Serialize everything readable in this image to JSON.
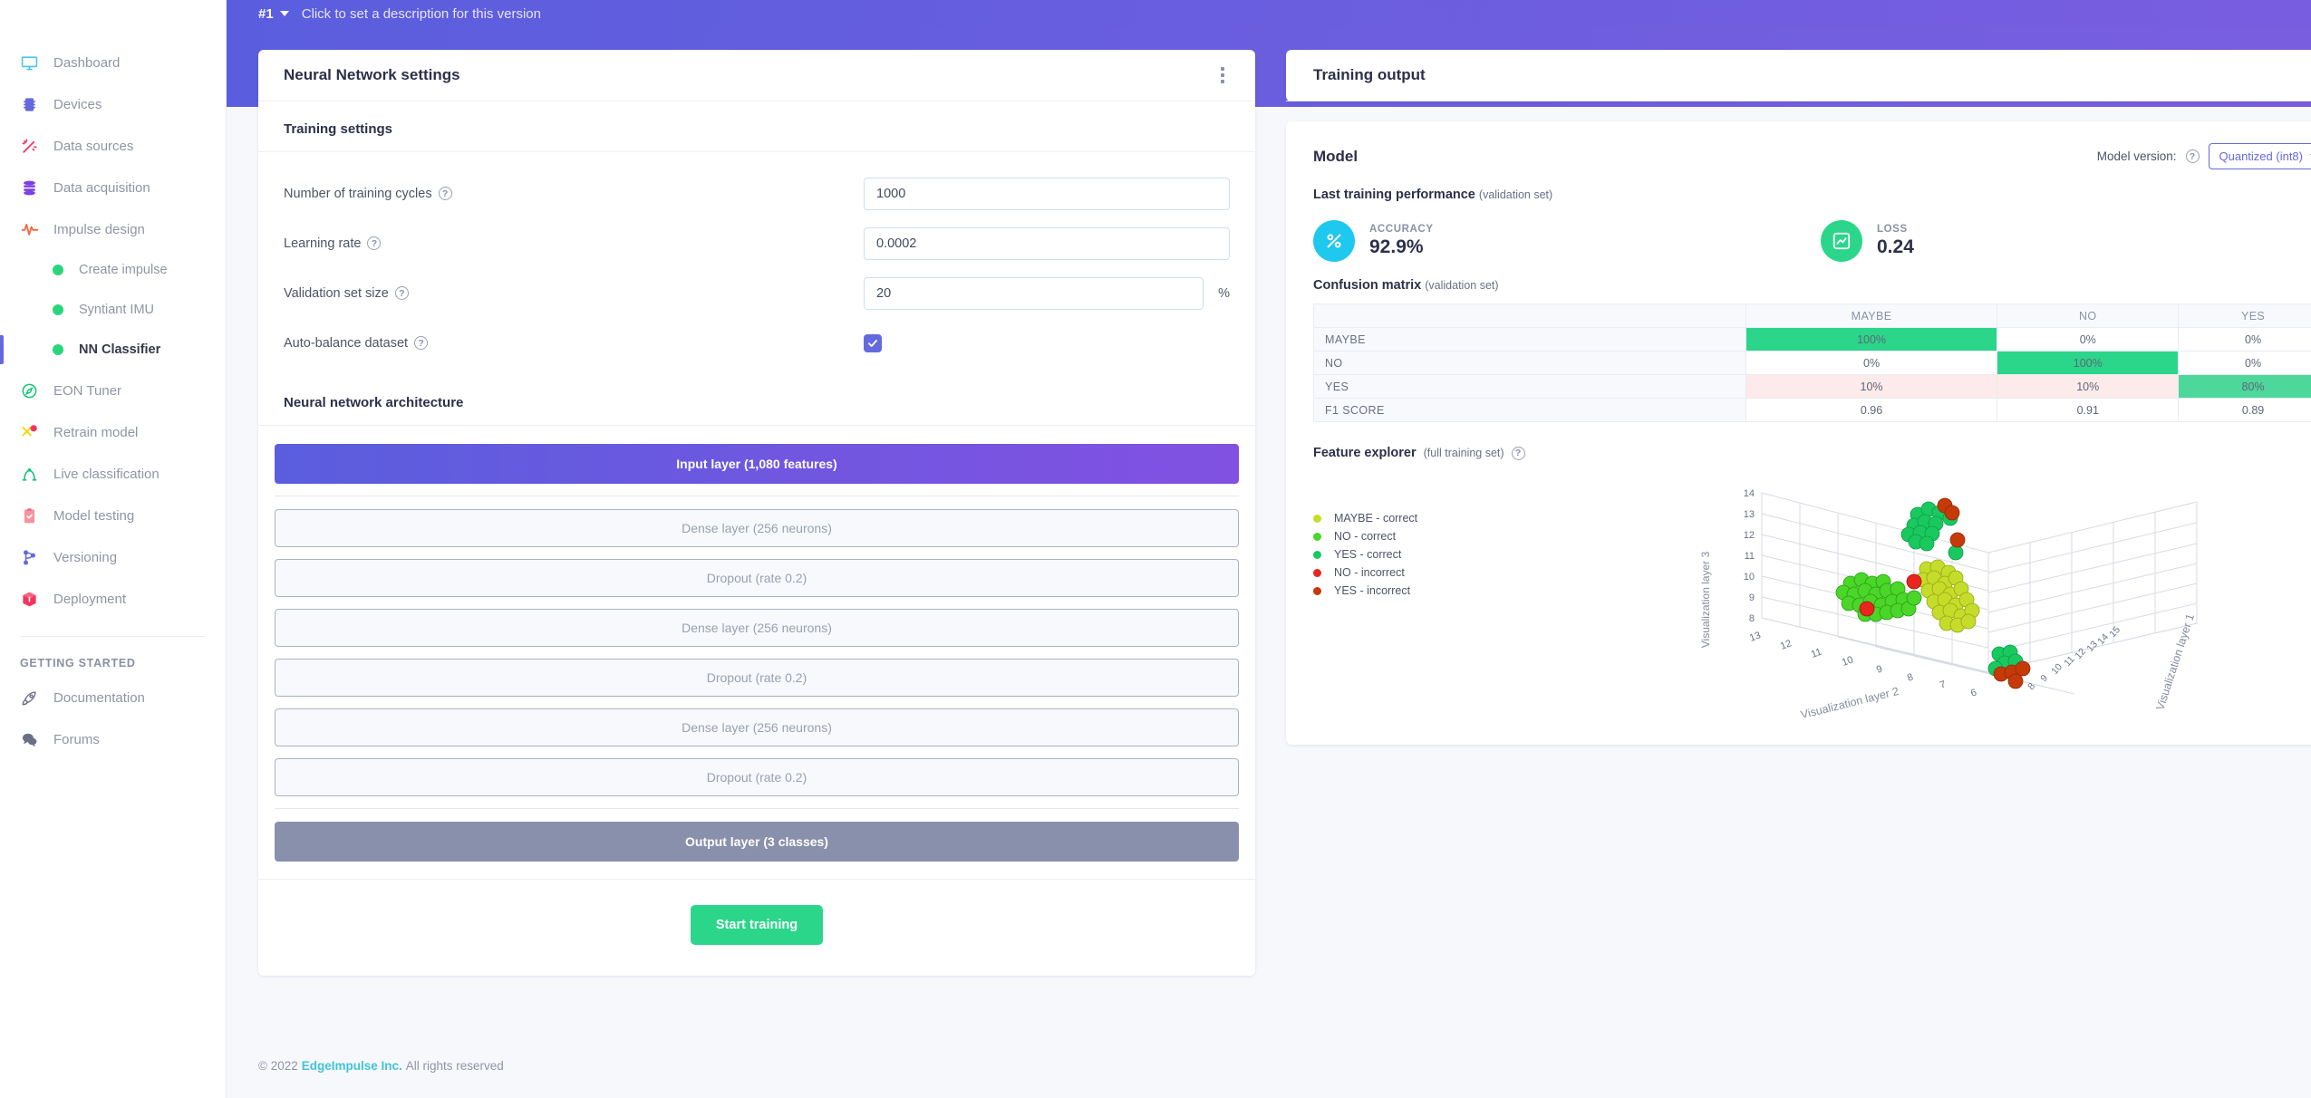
{
  "sidebar": {
    "items": [
      {
        "label": "Dashboard",
        "icon": "monitor-icon"
      },
      {
        "label": "Devices",
        "icon": "chip-icon"
      },
      {
        "label": "Data sources",
        "icon": "wand-icon"
      },
      {
        "label": "Data acquisition",
        "icon": "database-icon"
      },
      {
        "label": "Impulse design",
        "icon": "pulse-icon"
      }
    ],
    "sub_items": [
      {
        "label": "Create impulse",
        "active": false
      },
      {
        "label": "Syntiant IMU",
        "active": false
      },
      {
        "label": "NN Classifier",
        "active": true
      }
    ],
    "items2": [
      {
        "label": "EON Tuner",
        "icon": "compass-icon"
      },
      {
        "label": "Retrain model",
        "icon": "retrain-icon"
      },
      {
        "label": "Live classification",
        "icon": "antenna-icon"
      },
      {
        "label": "Model testing",
        "icon": "clipboard-check-icon"
      },
      {
        "label": "Versioning",
        "icon": "branch-icon"
      },
      {
        "label": "Deployment",
        "icon": "box-icon"
      }
    ],
    "section_label": "GETTING STARTED",
    "items3": [
      {
        "label": "Documentation",
        "icon": "rocket-icon"
      },
      {
        "label": "Forums",
        "icon": "chat-icon"
      }
    ]
  },
  "topbar": {
    "version": "#1",
    "description": "Click to set a description for this version"
  },
  "nn_card": {
    "title": "Neural Network settings",
    "menu_icon": "kebab-menu-icon",
    "training_settings_title": "Training settings",
    "fields": [
      {
        "label": "Number of training cycles",
        "value": "1000"
      },
      {
        "label": "Learning rate",
        "value": "0.0002"
      },
      {
        "label": "Validation set size",
        "value": "20",
        "suffix": "%"
      },
      {
        "label": "Auto-balance dataset",
        "value": "checked"
      }
    ],
    "arch_title": "Neural network architecture",
    "layers": [
      {
        "label": "Input layer (1,080 features)",
        "kind": "input"
      },
      {
        "label": "Dense layer (256 neurons)",
        "kind": "hidden"
      },
      {
        "label": "Dropout (rate 0.2)",
        "kind": "hidden"
      },
      {
        "label": "Dense layer (256 neurons)",
        "kind": "hidden"
      },
      {
        "label": "Dropout (rate 0.2)",
        "kind": "hidden"
      },
      {
        "label": "Dense layer (256 neurons)",
        "kind": "hidden"
      },
      {
        "label": "Dropout (rate 0.2)",
        "kind": "hidden"
      },
      {
        "label": "Output layer (3 classes)",
        "kind": "output"
      }
    ],
    "start_button": "Start training"
  },
  "training_output": {
    "title": "Training output",
    "model_title": "Model",
    "model_version_label": "Model version:",
    "model_version_value": "Quantized (int8)",
    "last_perf_title": "Last training performance",
    "last_perf_note": "(validation set)",
    "accuracy_label": "ACCURACY",
    "accuracy_value": "92.9%",
    "loss_label": "LOSS",
    "loss_value": "0.24",
    "confusion_title": "Confusion matrix",
    "confusion_note": "(validation set)",
    "feature_explorer_title": "Feature explorer",
    "feature_explorer_note": "(full training set)"
  },
  "chart_data": [
    {
      "type": "table",
      "title": "Confusion matrix (validation set)",
      "columns": [
        "",
        "MAYBE",
        "NO",
        "YES"
      ],
      "rows": [
        {
          "label": "MAYBE",
          "values": [
            "100%",
            "0%",
            "0%"
          ],
          "styles": [
            "green",
            "plain",
            "plain"
          ]
        },
        {
          "label": "NO",
          "values": [
            "0%",
            "100%",
            "0%"
          ],
          "styles": [
            "plain",
            "green",
            "plain"
          ]
        },
        {
          "label": "YES",
          "values": [
            "10%",
            "10%",
            "80%"
          ],
          "styles": [
            "pink",
            "pink",
            "greenlight"
          ]
        },
        {
          "label": "F1 SCORE",
          "values": [
            "0.96",
            "0.91",
            "0.89"
          ],
          "styles": [
            "plain",
            "plain",
            "plain"
          ]
        }
      ]
    },
    {
      "type": "scatter",
      "title": "Feature explorer (full training set)",
      "projection": "3d",
      "xlabel": "Visualization layer 2",
      "ylabel": "Visualization layer 3",
      "zlabel": "Visualization layer 1",
      "ylim": [
        8,
        14
      ],
      "yticks": [
        8,
        9,
        10,
        11,
        12,
        13,
        14
      ],
      "xlim": [
        6,
        13
      ],
      "xticks": [
        6,
        7,
        8,
        9,
        10,
        11,
        12,
        13
      ],
      "zlim": [
        8,
        15
      ],
      "zticks": [
        8,
        9,
        10,
        11,
        12,
        13,
        14,
        15
      ],
      "grid": true,
      "legend_position": "left",
      "series": [
        {
          "name": "MAYBE - correct",
          "color": "#c5dd2a",
          "count": 30
        },
        {
          "name": "NO - correct",
          "color": "#4bd62a",
          "count": 34
        },
        {
          "name": "YES - correct",
          "color": "#19c95f",
          "count": 26
        },
        {
          "name": "NO - incorrect",
          "color": "#e8261f",
          "count": 4
        },
        {
          "name": "YES - incorrect",
          "color": "#c63a0a",
          "count": 8
        }
      ]
    }
  ],
  "footer": {
    "copyright": "© 2022",
    "company": "EdgeImpulse Inc.",
    "rights": "All rights reserved"
  }
}
